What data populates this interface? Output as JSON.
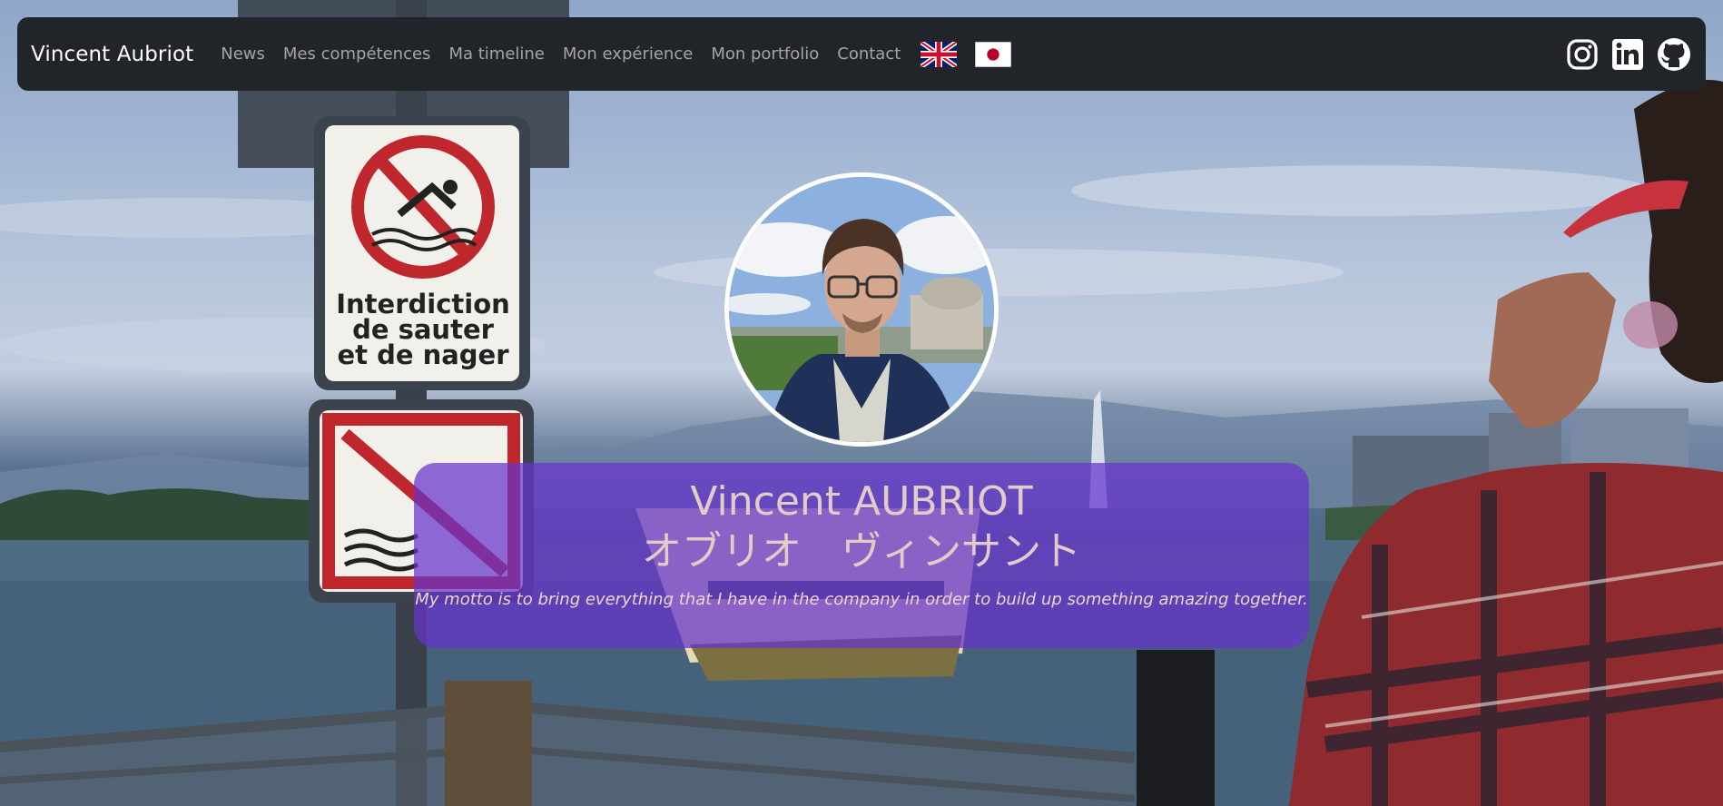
{
  "navbar": {
    "brand": "Vincent Aubriot",
    "links": [
      {
        "label": "News"
      },
      {
        "label": "Mes compétences"
      },
      {
        "label": "Ma timeline"
      },
      {
        "label": "Mon expérience"
      },
      {
        "label": "Mon portfolio"
      },
      {
        "label": "Contact"
      }
    ],
    "flags": [
      "uk-flag-icon",
      "japan-flag-icon"
    ],
    "socials": [
      "instagram-icon",
      "linkedin-icon",
      "github-icon"
    ]
  },
  "sign": {
    "line1": "Interdiction",
    "line2": "de sauter",
    "line3": "et de nager"
  },
  "hero": {
    "name": "Vincent AUBRIOT",
    "kana": "オブリオ　ヴィンサント",
    "motto": "My motto is to bring everything that I have in the company in order to build up something amazing together."
  },
  "colors": {
    "navbar_bg": "#212529",
    "hero_bg": "#6633cc",
    "hero_text": "#e3cbc7"
  }
}
